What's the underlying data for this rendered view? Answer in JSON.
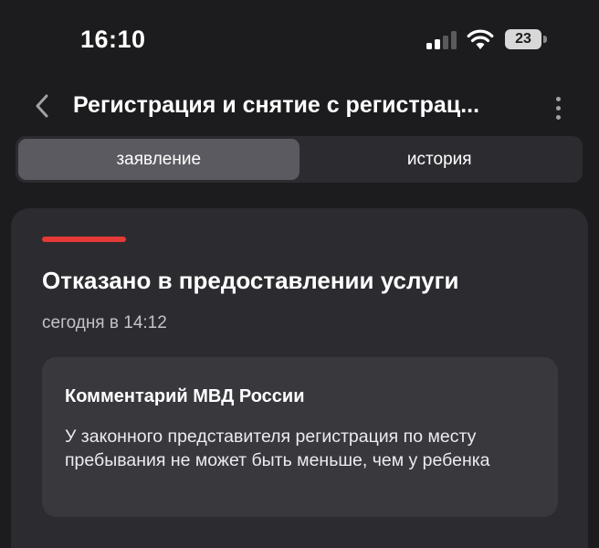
{
  "status_bar": {
    "time": "16:10",
    "battery": "23",
    "icons": [
      "signal-icon",
      "wifi-icon",
      "battery-icon"
    ]
  },
  "header": {
    "title": "Регистрация и снятие с регистрац...",
    "back_icon": "chevron-left-icon",
    "more_icon": "more-vertical-icon"
  },
  "tabs": [
    {
      "label": "заявление",
      "active": true
    },
    {
      "label": "история",
      "active": false
    }
  ],
  "status_card": {
    "accent_color": "#e53935",
    "title": "Отказано в предоставлении услуги",
    "date": "сегодня в 14:12",
    "comment": {
      "title": "Комментарий МВД России",
      "text": "У законного представителя регистрация по месту пребывания не может быть меньше, чем у ребенка"
    }
  }
}
